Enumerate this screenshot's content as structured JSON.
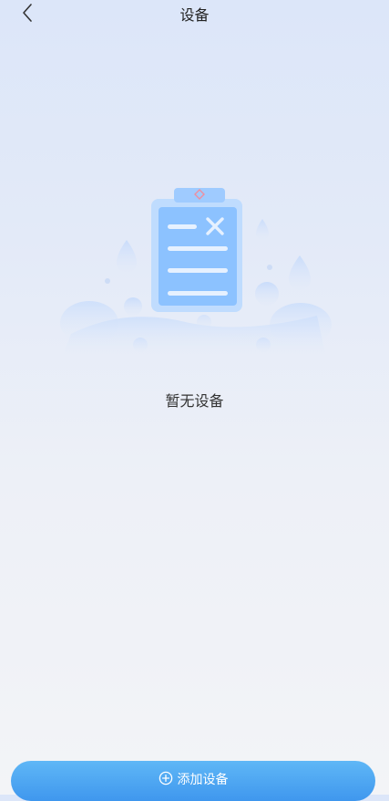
{
  "header": {
    "title": "设备",
    "back_icon": "chevron-left-icon"
  },
  "empty_state": {
    "illustration_icon": "empty-clipboard-icon",
    "message": "暂无设备"
  },
  "footer": {
    "add_button_label": "添加设备",
    "add_icon": "plus-circle-icon"
  },
  "colors": {
    "accent": "#3f97ee",
    "illustration": "#8cc2ff"
  }
}
